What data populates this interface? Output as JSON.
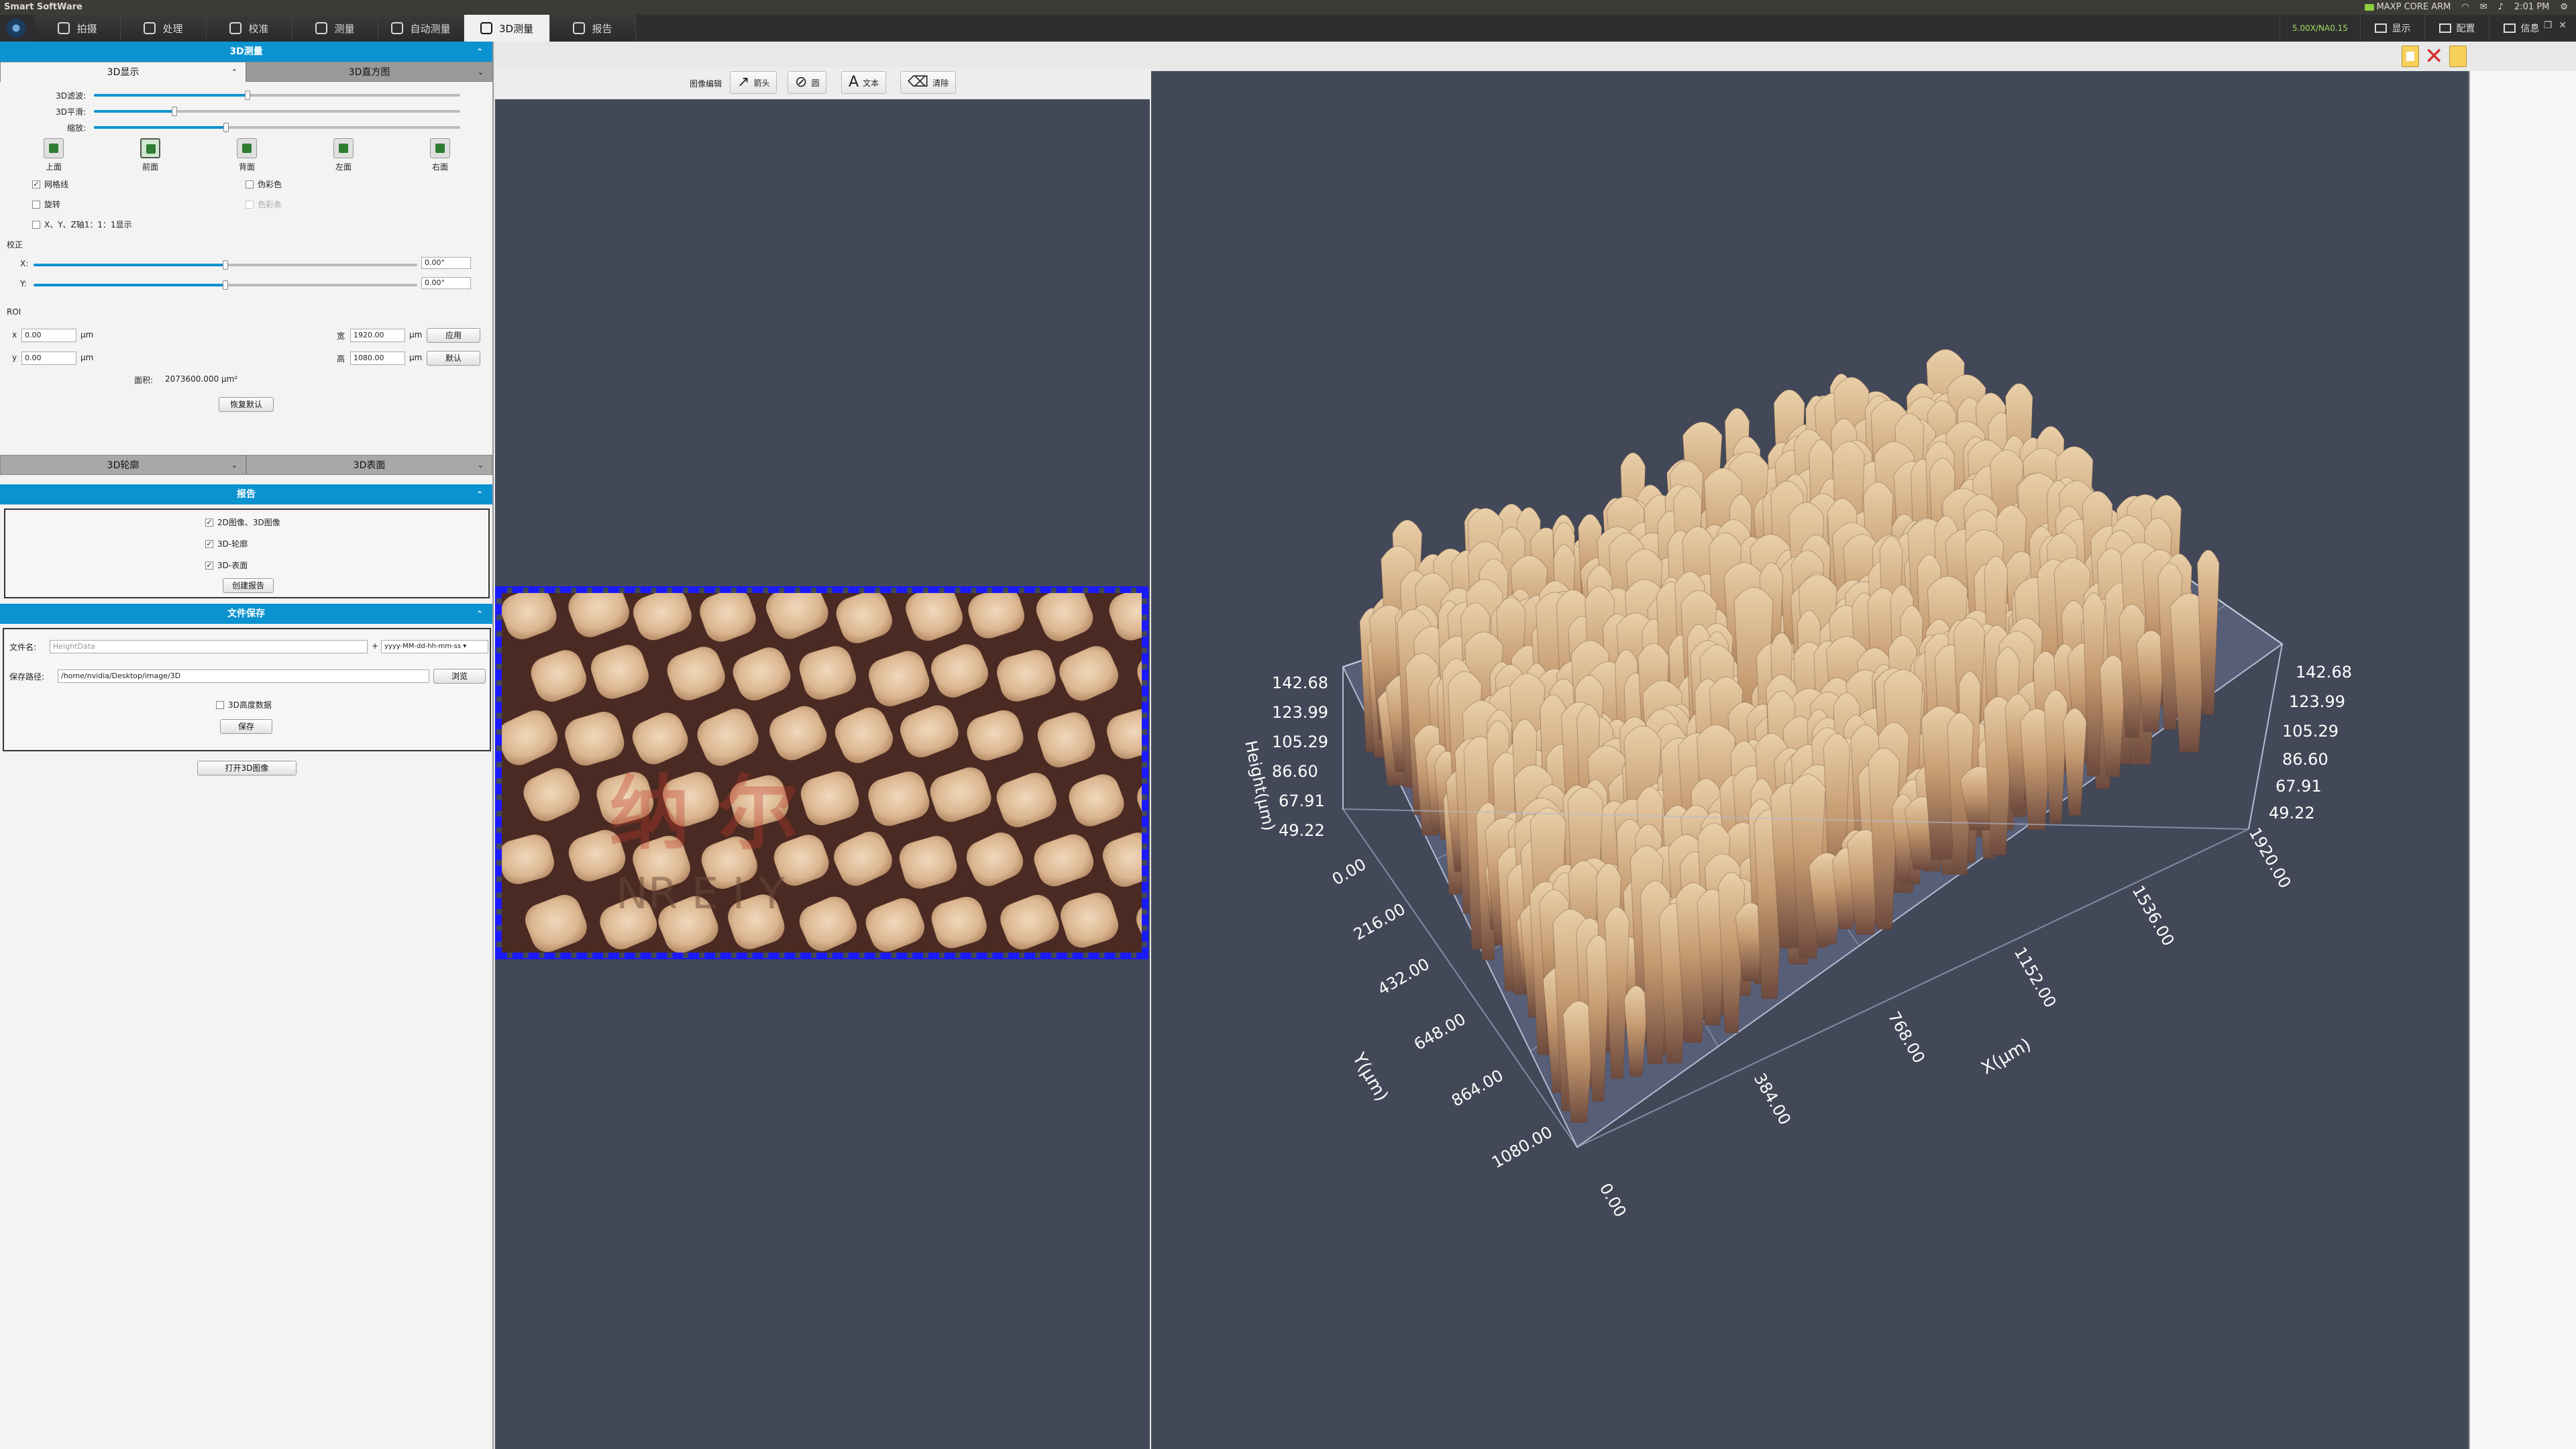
{
  "window": {
    "title": "Smart SoftWare"
  },
  "tray": {
    "brand": "MAXP CORE ARM",
    "time": "2:01 PM"
  },
  "tabs": [
    "拍摄",
    "处理",
    "校准",
    "测量",
    "自动测量",
    "3D测量",
    "报告"
  ],
  "right_buttons": {
    "gpu": "5.00X/NA0.15",
    "display": "显示",
    "config": "配置",
    "info": "信息"
  },
  "panel": {
    "header": "3D测量",
    "subtabs": {
      "display": "3D显示",
      "histogram": "3D直方图"
    },
    "sliders": {
      "filter_label": "3D滤波:",
      "filter_value": 0.42,
      "smooth_label": "3D平滑:",
      "smooth_value": 0.22,
      "zoom_label": "缩放:",
      "zoom_value": 0.36
    },
    "views": [
      "上面",
      "前面",
      "背面",
      "左面",
      "右面"
    ],
    "checks": {
      "grid": "网格线",
      "pseudo": "伪彩色",
      "rotate": "旋转",
      "colorbar": "色彩条",
      "ratio": "X、Y、Z轴1：1：1显示"
    },
    "correction": {
      "title": "校正",
      "x_label": "X:",
      "x_value": "0.00°",
      "y_label": "Y:",
      "y_value": "0.00°",
      "x_pos": 0.5,
      "y_pos": 0.5
    },
    "roi": {
      "title": "ROI",
      "x_label": "x",
      "x_value": "0.00",
      "y_label": "y",
      "y_value": "0.00",
      "unit": "µm",
      "w_label": "宽",
      "w_value": "1920.00",
      "h_label": "高",
      "h_value": "1080.00",
      "apply": "应用",
      "default": "默认",
      "area_label": "面积:",
      "area_value": "2073600.000 µm²",
      "restore": "恢复默认"
    },
    "contour": "3D轮廓",
    "surface": "3D表面",
    "report": {
      "header": "报告",
      "opt1": "2D图像、3D图像",
      "opt2": "3D-轮廓",
      "opt3": "3D-表面",
      "create": "创建报告"
    },
    "save": {
      "header": "文件保存",
      "filename_label": "文件名:",
      "filename_placeholder": "HeightData",
      "plus": "+",
      "format": "yyyy-MM-dd-hh-mm-ss",
      "path_label": "保存路径:",
      "path_value": "/home/nvidia/Desktop/image/3D",
      "browse": "浏览",
      "height_data": "3D高度数据",
      "save": "保存",
      "open3d": "打开3D图像"
    }
  },
  "image_toolbar": {
    "title": "图像编辑",
    "arrow": "箭头",
    "circle": "圆",
    "text": "文本",
    "clear": "清除"
  },
  "watermark": {
    "line1": "纳   尔",
    "line2": "NR E    I   Y"
  },
  "plot3d": {
    "z_label": "Height(µm)",
    "y_label": "Y(µm)",
    "x_label": "X(µm)",
    "z_ticks": [
      "142.68",
      "123.99",
      "105.29",
      "86.60",
      "67.91",
      "49.22"
    ],
    "y_ticks": [
      "0.00",
      "216.00",
      "432.00",
      "648.00",
      "864.00",
      "1080.00"
    ],
    "x_ticks": [
      "0.00",
      "384.00",
      "768.00",
      "1152.00",
      "1536.00",
      "1920.00"
    ]
  }
}
